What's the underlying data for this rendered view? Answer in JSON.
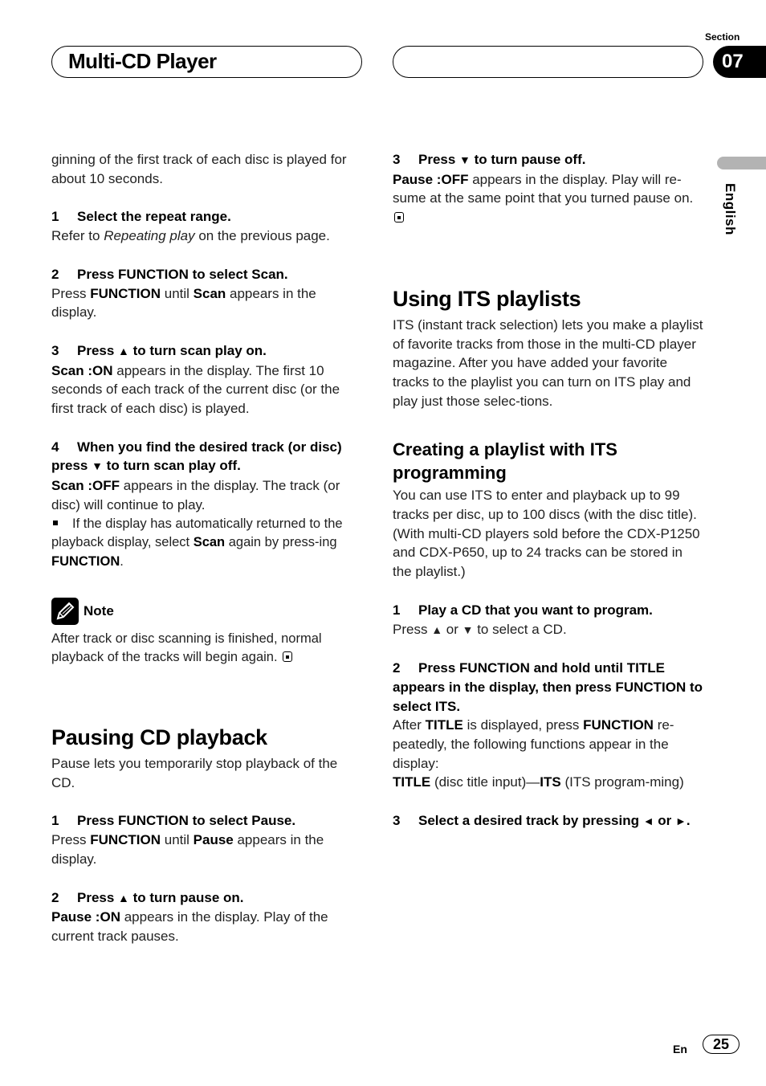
{
  "header": {
    "title": "Multi-CD Player",
    "section_label": "Section",
    "section_number": "07",
    "language_tab": "English"
  },
  "left_column": {
    "intro": "ginning of the first track of each disc is played for about 10 seconds.",
    "steps": [
      {
        "num": "1",
        "title": "Select the repeat range.",
        "body_pre": "Refer to ",
        "body_italic": "Repeating play",
        "body_post": " on the previous page."
      },
      {
        "num": "2",
        "title": "Press FUNCTION to select Scan.",
        "body": [
          "Press ",
          "FUNCTION",
          " until ",
          "Scan",
          " appears in the display."
        ]
      },
      {
        "num": "3",
        "title_pre": "Press ",
        "title_sym": "▲",
        "title_post": " to turn scan play on.",
        "body_bold": "Scan :ON",
        "body": " appears in the display. The first 10 seconds of each track of the current disc (or the first track of each disc) is played."
      },
      {
        "num": "4",
        "title_pre": "When you find the desired track (or disc) press ",
        "title_sym": "▼",
        "title_post": " to turn scan play off.",
        "body_bold": "Scan :OFF",
        "body": " appears in the display. The track (or disc) will continue to play.",
        "bullet": [
          "If the display has automatically returned to the playback display, select ",
          "Scan",
          " again by press-ing ",
          "FUNCTION",
          "."
        ]
      }
    ],
    "note": {
      "title": "Note",
      "body": "After track or disc scanning is finished, normal playback of the tracks will begin again."
    },
    "pausing": {
      "heading": "Pausing CD playback",
      "intro": "Pause lets you temporarily stop playback of the CD.",
      "steps": [
        {
          "num": "1",
          "title": "Press FUNCTION to select Pause.",
          "body": [
            "Press ",
            "FUNCTION",
            " until ",
            "Pause",
            " appears in the display."
          ]
        },
        {
          "num": "2",
          "title_pre": "Press ",
          "title_sym": "▲",
          "title_post": " to turn pause on.",
          "body_bold": "Pause :ON",
          "body": " appears in the display. Play of the current track pauses."
        }
      ]
    }
  },
  "right_column": {
    "pause_step3": {
      "num": "3",
      "title_pre": "Press ",
      "title_sym": "▼",
      "title_post": " to turn pause off.",
      "body_bold": "Pause :OFF",
      "body": " appears in the display. Play will re-sume at the same point that you turned pause on."
    },
    "its": {
      "heading": "Using ITS playlists",
      "intro": "ITS (instant track selection) lets you make a playlist of favorite tracks from those in the multi-CD player magazine. After you have added your favorite tracks to the playlist you can turn on ITS play and play just those selec-tions."
    },
    "creating": {
      "heading": "Creating a playlist with ITS programming",
      "intro": "You can use ITS to enter and playback up to 99 tracks per disc, up to 100 discs (with the disc title). (With multi-CD players sold before the CDX-P1250 and CDX-P650, up to 24 tracks can be stored in the playlist.)",
      "steps": [
        {
          "num": "1",
          "title": "Play a CD that you want to program.",
          "body": [
            "Press ",
            "▲",
            " or ",
            "▼",
            " to select a CD."
          ]
        },
        {
          "num": "2",
          "title": "Press FUNCTION and hold until TITLE appears in the display, then press FUNCTION to select ITS.",
          "body": [
            "After ",
            "TITLE",
            " is displayed, press ",
            "FUNCTION",
            " re-peatedly, the following functions appear in the display:"
          ],
          "body2": [
            "TITLE",
            " (disc title input)—",
            "ITS",
            " (ITS program-ming)"
          ]
        },
        {
          "num": "3",
          "title_pre": "Select a desired track by pressing ",
          "title_sym": "◄",
          "title_mid": " or ",
          "title_sym2": "►",
          "title_post": "."
        }
      ]
    }
  },
  "footer": {
    "lang_code": "En",
    "page_number": "25"
  }
}
